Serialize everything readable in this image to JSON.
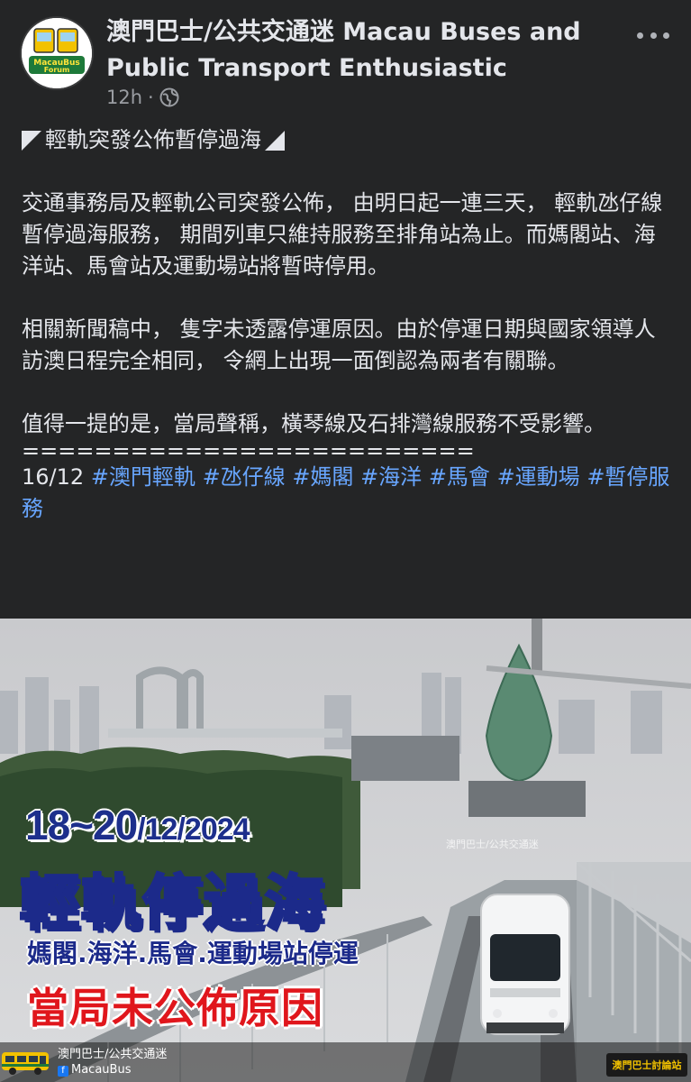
{
  "post": {
    "page_name": "澳門巴士/公共交通迷 Macau Buses and Public Transport Enthusiastic",
    "avatar_label": "MacauBus Forum",
    "time": "12h",
    "separator_dot": "·",
    "visibility_icon": "globe-icon",
    "more_icon": "more-dots-icon"
  },
  "content": {
    "title": "輕軌突發公佈暫停過海",
    "para1": "交通事務局及輕軌公司突發公佈， 由明日起一連三天， 輕軌氹仔線暫停過海服務， 期間列車只維持服務至排角站為止。而媽閣站、海洋站、馬會站及運動場站將暫時停用。",
    "para2": "相關新聞稿中， 隻字未透露停運原因。由於停運日期與國家領導人訪澳日程完全相同， 令網上出現一面倒認為兩者有關聯。",
    "para3": "值得一提的是，當局聲稱，橫琴線及石排灣線服務不受影響。",
    "divider": "=========================",
    "date": "16/12",
    "hashtags": [
      "#澳門輕軌",
      "#氹仔線",
      "#媽閣",
      "#海洋",
      "#馬會",
      "#運動場",
      "#暫停服務"
    ]
  },
  "image": {
    "date_range": "18~20",
    "date_suffix": "/12/2024",
    "headline": "輕軌停過海",
    "subline": "媽閣.海洋.馬會.運動場站停運",
    "red_line": "當局未公佈原因",
    "watermark": "澳門巴士/公共交通迷",
    "footer_name": "澳門巴士/公共交通迷",
    "footer_fb": "MacauBus",
    "corner_logo": "澳門巴士討論站"
  },
  "colors": {
    "background": "#242526",
    "text": "#e4e6eb",
    "muted": "#9a9da2",
    "hashtag": "#68a6ff",
    "headline_yellow": "#ffe43a",
    "headline_blue": "#1c2a8a",
    "alert_red": "#e0161c"
  }
}
